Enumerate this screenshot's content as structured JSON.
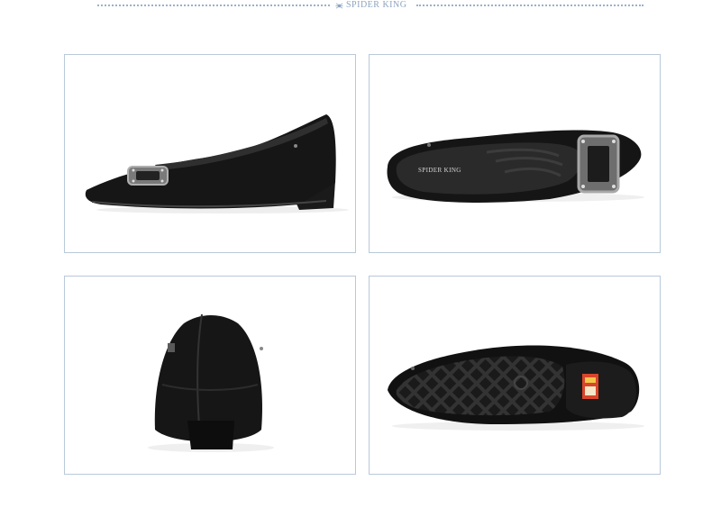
{
  "header": {
    "brand_name": "SPIDER KING",
    "logo_icon": "spider-icon",
    "divider_color": "#9db0c8"
  },
  "gallery": {
    "border_color": "#b9c9da",
    "panels": [
      {
        "view": "side",
        "icon": "shoe-side-icon"
      },
      {
        "view": "top",
        "icon": "shoe-top-icon",
        "insole_text": "SPIDER KING"
      },
      {
        "view": "back",
        "icon": "shoe-back-icon"
      },
      {
        "view": "sole",
        "icon": "shoe-sole-icon"
      }
    ]
  }
}
